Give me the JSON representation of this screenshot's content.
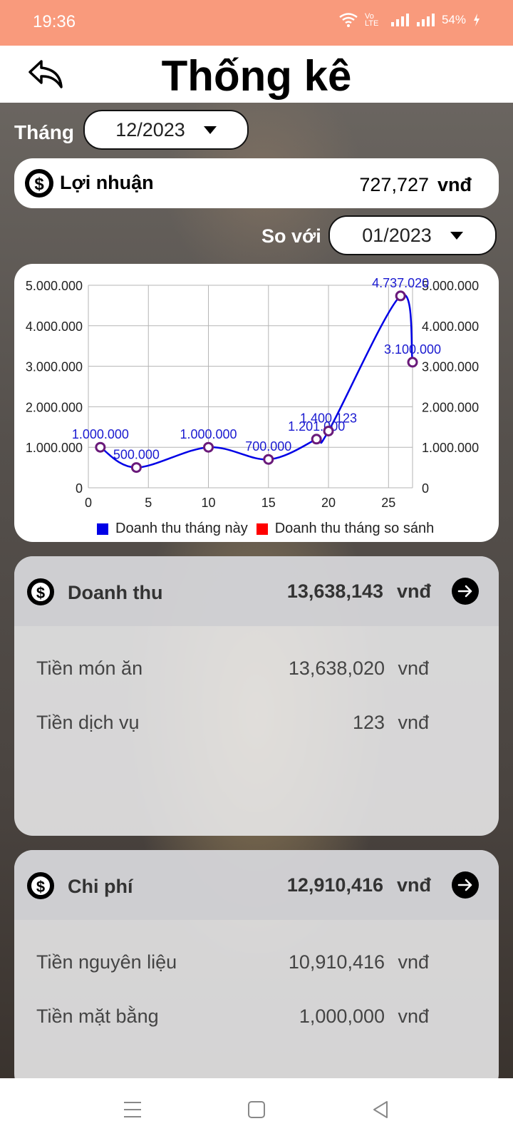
{
  "status_bar": {
    "time": "19:36",
    "battery": "54%",
    "network": "Vo LTE"
  },
  "app_bar": {
    "title": "Thống kê"
  },
  "filters": {
    "month_label": "Tháng",
    "month_value": "12/2023",
    "compare_label": "So với",
    "compare_value": "01/2023"
  },
  "profit": {
    "label": "Lợi nhuận",
    "value": "727,727",
    "unit": "vnđ"
  },
  "chart_data": {
    "type": "line",
    "series": [
      {
        "name": "Doanh thu tháng này",
        "color": "#0000e6",
        "x": [
          1,
          4,
          10,
          15,
          19,
          20,
          26,
          27
        ],
        "y": [
          1000000,
          500000,
          1000000,
          700000,
          1201000,
          1400123,
          4737020,
          3100000
        ],
        "labels": [
          "1.000.000",
          "500.000",
          "1.000.000",
          "700.000",
          "1.201.000",
          "1.400.123",
          "4.737.020",
          "3.100.000"
        ]
      },
      {
        "name": "Doanh thu tháng so sánh",
        "color": "#ff0000",
        "x": [],
        "y": [],
        "labels": []
      }
    ],
    "xlim": [
      0,
      27
    ],
    "ylim": [
      0,
      5000000
    ],
    "x_ticks": [
      "0",
      "5",
      "10",
      "15",
      "20",
      "25"
    ],
    "y_ticks": [
      "0",
      "1.000.000",
      "2.000.000",
      "3.000.000",
      "4.000.000",
      "5.000.000"
    ],
    "grid": true,
    "legend": "bottom"
  },
  "revenue": {
    "title": "Doanh thu",
    "total": "13,638,143",
    "unit": "vnđ",
    "rows": [
      {
        "label": "Tiền món ăn",
        "value": "13,638,020",
        "unit": "vnđ"
      },
      {
        "label": "Tiền dịch vụ",
        "value": "123",
        "unit": "vnđ"
      }
    ]
  },
  "expense": {
    "title": "Chi phí",
    "total": "12,910,416",
    "unit": "vnđ",
    "rows": [
      {
        "label": "Tiền nguyên liệu",
        "value": "10,910,416",
        "unit": "vnđ"
      },
      {
        "label": "Tiền mặt bằng",
        "value": "1,000,000",
        "unit": "vnđ"
      }
    ]
  },
  "icons": {
    "dollar": "$"
  }
}
